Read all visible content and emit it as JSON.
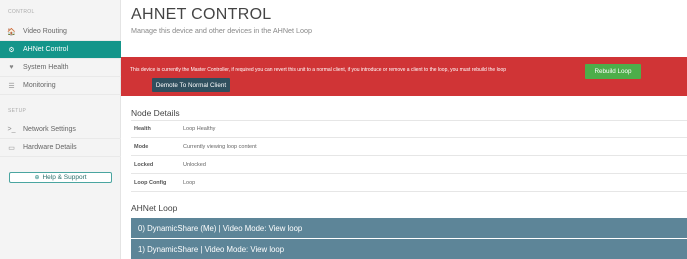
{
  "sidebar": {
    "section_control": "CONTROL",
    "section_setup": "SETUP",
    "items": [
      {
        "label": "Video Routing",
        "icon": "home-icon",
        "glyph": "🏠"
      },
      {
        "label": "AHNet Control",
        "icon": "cogs-icon",
        "glyph": "⚙"
      },
      {
        "label": "System Health",
        "icon": "heart-icon",
        "glyph": "♥"
      },
      {
        "label": "Monitoring",
        "icon": "rss-icon",
        "glyph": "☰"
      },
      {
        "label": "Network Settings",
        "icon": "terminal-icon",
        "glyph": ">_"
      },
      {
        "label": "Hardware Details",
        "icon": "hdd-icon",
        "glyph": "▭"
      }
    ],
    "help_button": {
      "label": "Help & Support",
      "icon": "plus-circle-icon",
      "glyph": "⊕"
    }
  },
  "header": {
    "title": "AHNET CONTROL",
    "subtitle": "Manage this device and other devices in the AHNet Loop"
  },
  "alert": {
    "message": "This device is currently the Master Controller, if required you can revert this unit to a normal client, if you introduce or remove a client to the loop, you must rebuild the loop",
    "demote_label": "Demote To Normal Client",
    "rebuild_label": "Rebuild Loop"
  },
  "node_details": {
    "heading": "Node Details",
    "rows": [
      {
        "key": "Health",
        "value": "Loop Healthy"
      },
      {
        "key": "Mode",
        "value": "Currently viewing loop content"
      },
      {
        "key": "Locked",
        "value": "Unlocked"
      },
      {
        "key": "Loop Config",
        "value": "Loop"
      }
    ]
  },
  "ahnet_loop": {
    "heading": "AHNet Loop",
    "items": [
      "0) DynamicShare (Me) | Video Mode: View loop",
      "1) DynamicShare | Video Mode: View loop"
    ]
  },
  "colors": {
    "accent": "#14958a",
    "alert": "#d03436",
    "demote_button": "#2f4f5e",
    "rebuild_button": "#4dae4a",
    "loop_item": "#5d8598"
  }
}
